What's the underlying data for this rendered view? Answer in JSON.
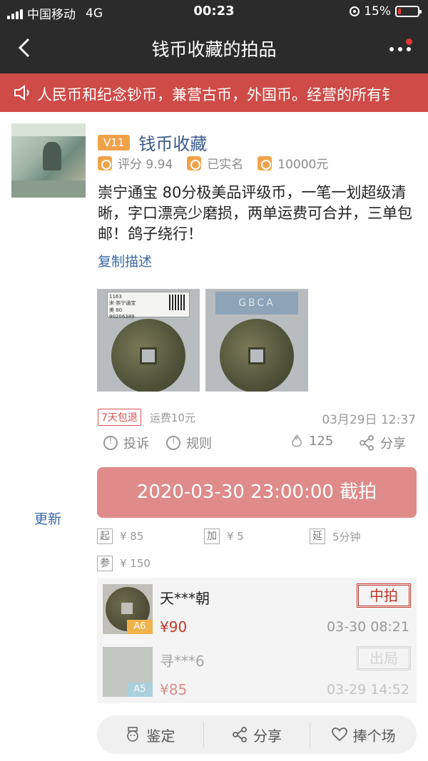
{
  "statusbar": {
    "carrier": "中国移动",
    "network": "4G",
    "time": "00:23",
    "battery": "15%"
  },
  "navbar": {
    "title": "钱币收藏的拍品"
  },
  "notice": {
    "text": "人民币和纪念钞币，兼营古币，外国币。经营的所有钅"
  },
  "seller": {
    "vip_level": "V11",
    "name": "钱币收藏",
    "rating": "评分 9.94",
    "verified": "已实名",
    "deposit": "10000元"
  },
  "item": {
    "description": "崇宁通宝 80分极美品评级币，一笔一划超级清晰，字口漂亮少磨损，两单运费可合并，三单包邮！鸽子绕行！",
    "copy_label": "复制描述",
    "photo1_label_line1": "1163",
    "photo1_label_line2": "宋·崇宁通宝",
    "photo1_label_line3": "美 80",
    "photo1_label_line4": "90206389",
    "photo2_label": "GBCA"
  },
  "policy": {
    "return_badge": "7天包退",
    "shipping": "运费10元",
    "post_time": "03月29日 12:37"
  },
  "actions": {
    "complain": "投诉",
    "rules": "规则",
    "heat": "125",
    "share": "分享"
  },
  "auction": {
    "update_label": "更新",
    "deadline": "2020-03-30 23:00:00 截拍",
    "start_tag": "起",
    "start_price": "¥ 85",
    "increment_tag": "加",
    "increment": "¥ 5",
    "extend_tag": "延",
    "extend": "5分钟",
    "ref_tag": "参",
    "ref_price": "¥ 150"
  },
  "bids": [
    {
      "name": "天***朝",
      "level": "A6",
      "price": "¥90",
      "time": "03-30 08:21",
      "status": "中拍"
    },
    {
      "name": "寻***6",
      "level": "A5",
      "price": "¥85",
      "time": "03-29 14:52",
      "status": "出局"
    }
  ],
  "bottom": {
    "appraise": "鉴定",
    "share": "分享",
    "support": "捧个场"
  },
  "colors": {
    "header_bg": "#2b2b2b",
    "notice_bg": "#cf4b47",
    "deadline_btn": "#de8b8a",
    "vip_badge": "#f0a24a",
    "link": "#3b6aa4",
    "price": "#c0392b"
  }
}
